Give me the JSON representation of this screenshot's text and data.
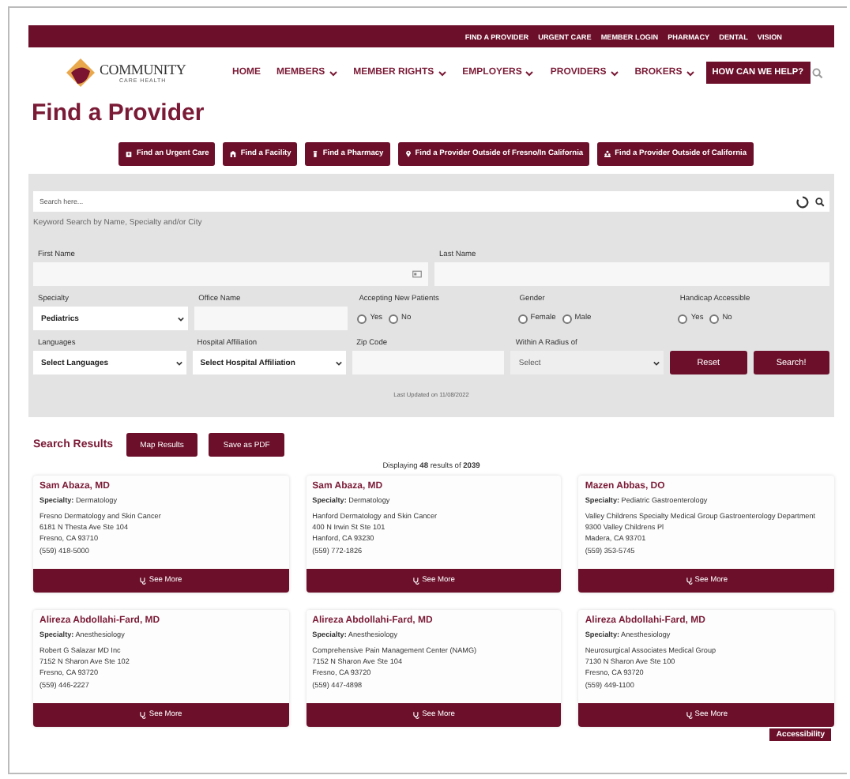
{
  "utility_nav": [
    "FIND A PROVIDER",
    "URGENT CARE",
    "MEMBER LOGIN",
    "PHARMACY",
    "DENTAL",
    "VISION"
  ],
  "logo": {
    "name": "COMMUNITY",
    "tagline": "CARE HEALTH"
  },
  "main_nav": [
    {
      "label": "HOME",
      "dropdown": false
    },
    {
      "label": "MEMBERS",
      "dropdown": true
    },
    {
      "label": "MEMBER RIGHTS",
      "dropdown": true
    },
    {
      "label": "EMPLOYERS",
      "dropdown": true
    },
    {
      "label": "PROVIDERS",
      "dropdown": true
    },
    {
      "label": "BROKERS",
      "dropdown": true
    }
  ],
  "help_button": "HOW CAN WE HELP?",
  "page_title": "Find a Provider",
  "quick_links": [
    "Find an Urgent Care",
    "Find a Facility",
    "Find a Pharmacy",
    "Find a Provider Outside of Fresno/In California",
    "Find a Provider Outside of California"
  ],
  "search": {
    "placeholder": "Search here...",
    "hint": "Keyword Search by Name, Specialty and/or City"
  },
  "form_rows": [
    [
      {
        "kind": "text",
        "label": "First Name",
        "card_icon": true
      },
      {
        "kind": "text",
        "label": "Last Name",
        "card_icon": false
      }
    ],
    [
      {
        "kind": "select",
        "label": "Specialty",
        "value": "Pediatrics"
      },
      {
        "kind": "text",
        "label": "Office Name",
        "card_icon": false
      },
      {
        "kind": "radio",
        "label": "Accepting New Patients",
        "options": [
          {
            "label": "Yes",
            "selected": false
          },
          {
            "label": "No",
            "selected": false
          }
        ]
      },
      {
        "kind": "radio",
        "label": "Gender",
        "options": [
          {
            "label": "Female",
            "selected": false
          },
          {
            "label": "Male",
            "selected": false
          }
        ]
      },
      {
        "kind": "radio",
        "label": "Handicap Accessible",
        "options": [
          {
            "label": "Yes",
            "selected": false
          },
          {
            "label": "No",
            "selected": false
          }
        ]
      }
    ],
    [
      {
        "kind": "select",
        "label": "Languages",
        "value": "Select Languages"
      },
      {
        "kind": "select",
        "label": "Hospital Affiliation",
        "value": "Select Hospital Affiliation"
      },
      {
        "kind": "text",
        "label": "Zip Code",
        "card_icon": false
      },
      {
        "kind": "select",
        "label": "Within A Radius of",
        "value": "Select",
        "muted": true
      },
      {
        "kind": "button",
        "label": "Reset"
      },
      {
        "kind": "button",
        "label": "Search!"
      }
    ]
  ],
  "last_updated": "Last Updated on 11/08/2022",
  "results": {
    "title": "Search Results",
    "buttons": [
      "Map Results",
      "Save as PDF"
    ],
    "summary": "Displaying **48** results of **2039**",
    "cards": [
      {
        "name": "Sam Abaza, MD",
        "specialty_label": "Specialty:",
        "specialty": "Dermatology",
        "office": "Fresno Dermatology and Skin Cancer",
        "address": "6181 N Thesta Ave Ste 104",
        "city": "Fresno, CA 93710",
        "phone": "(559) 418-5000",
        "button": "See More"
      },
      {
        "name": "Sam Abaza, MD",
        "specialty_label": "Specialty:",
        "specialty": "Dermatology",
        "office": "Hanford Dermatology and Skin Cancer",
        "address": "400 N Irwin St Ste 101",
        "city": "Hanford, CA 93230",
        "phone": "(559) 772-1826",
        "button": "See More"
      },
      {
        "name": "Mazen Abbas, DO",
        "specialty_label": "Specialty:",
        "specialty": "Pediatric Gastroenterology",
        "office": "Valley Childrens Specialty Medical Group Gastroenterology Department",
        "address": "9300 Valley Childrens Pl",
        "city": "Madera, CA 93701",
        "phone": "(559) 353-5745",
        "button": "See More"
      },
      {
        "name": "Alireza Abdollahi-Fard, MD",
        "specialty_label": "Specialty:",
        "specialty": "Anesthesiology",
        "office": "Robert G Salazar MD Inc",
        "address": "7152 N Sharon Ave Ste 102",
        "city": "Fresno, CA 93720",
        "phone": "(559) 446-2227",
        "button": "See More"
      },
      {
        "name": "Alireza Abdollahi-Fard, MD",
        "specialty_label": "Specialty:",
        "specialty": "Anesthesiology",
        "office": "Comprehensive Pain Management Center (NAMG)",
        "address": "7152 N Sharon Ave Ste 104",
        "city": "Fresno, CA 93720",
        "phone": "(559) 447-4898",
        "button": "See More"
      },
      {
        "name": "Alireza Abdollahi-Fard, MD",
        "specialty_label": "Specialty:",
        "specialty": "Anesthesiology",
        "office": "Neurosurgical Associates Medical Group",
        "address": "7130 N Sharon Ave Ste 100",
        "city": "Fresno, CA 93720",
        "phone": "(559) 449-1100",
        "button": "See More"
      }
    ]
  },
  "accessibility_badge": "Accessibility"
}
